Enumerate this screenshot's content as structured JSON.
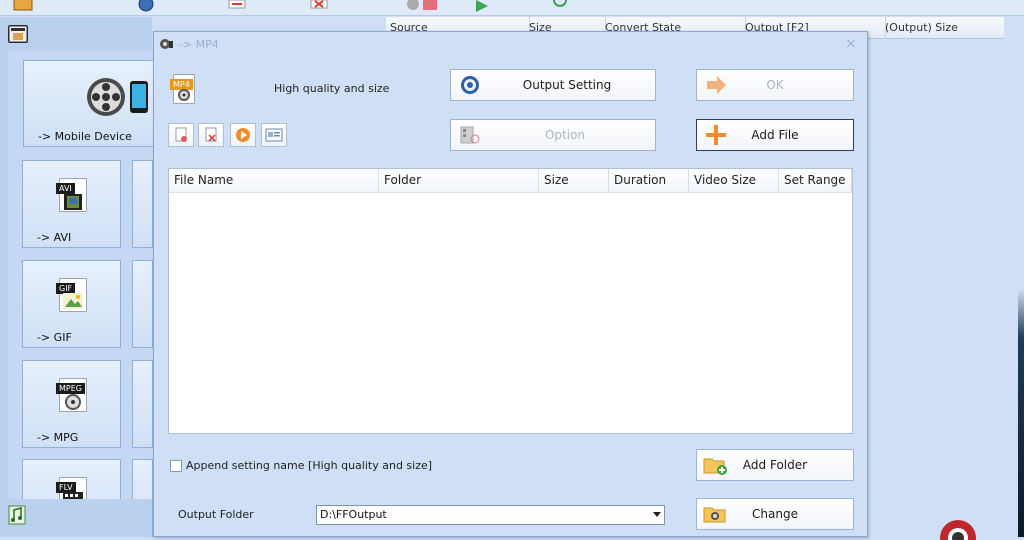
{
  "background": {
    "list_columns": [
      "Source",
      "Size",
      "Convert State",
      "Output [F2]",
      "(Output) Size"
    ],
    "tiles": [
      {
        "label": "-> Mobile Device"
      },
      {
        "label": "-> AVI",
        "tag": "AVI"
      },
      {
        "label": "-> GIF",
        "tag": "GIF"
      },
      {
        "label": "-> MPG",
        "tag": "MPEG"
      },
      {
        "tag": "FLV"
      }
    ]
  },
  "dialog": {
    "title": "-> MP4",
    "close_glyph": "×",
    "format_badge": "MP4",
    "quality_text": "High quality and size",
    "buttons": {
      "output_setting": "Output Setting",
      "ok": "OK",
      "option": "Option",
      "add_file": "Add File",
      "add_folder": "Add Folder",
      "change": "Change"
    },
    "file_table": {
      "columns": [
        "File Name",
        "Folder",
        "Size",
        "Duration",
        "Video Size",
        "Set Range"
      ],
      "rows": []
    },
    "append_setting": {
      "label": "Append setting name [High quality and size]",
      "checked": false
    },
    "output_folder": {
      "label": "Output Folder",
      "value": "D:\\FFOutput"
    }
  },
  "colors": {
    "window_bg": "#cfe0f6",
    "add_icon": "#f28c28",
    "ok_icon": "#f6b27a"
  },
  "icons": [
    "mobile-device-icon",
    "avi-file-icon",
    "gif-file-icon",
    "mpg-file-icon",
    "flv-file-icon",
    "mp4-file-icon",
    "output-setting-icon",
    "option-icon",
    "ok-arrow-icon",
    "add-file-icon",
    "add-folder-icon",
    "change-folder-icon",
    "remove-icon",
    "clear-list-icon",
    "play-icon",
    "media-info-icon",
    "music-icon",
    "film-clapper-icon"
  ]
}
